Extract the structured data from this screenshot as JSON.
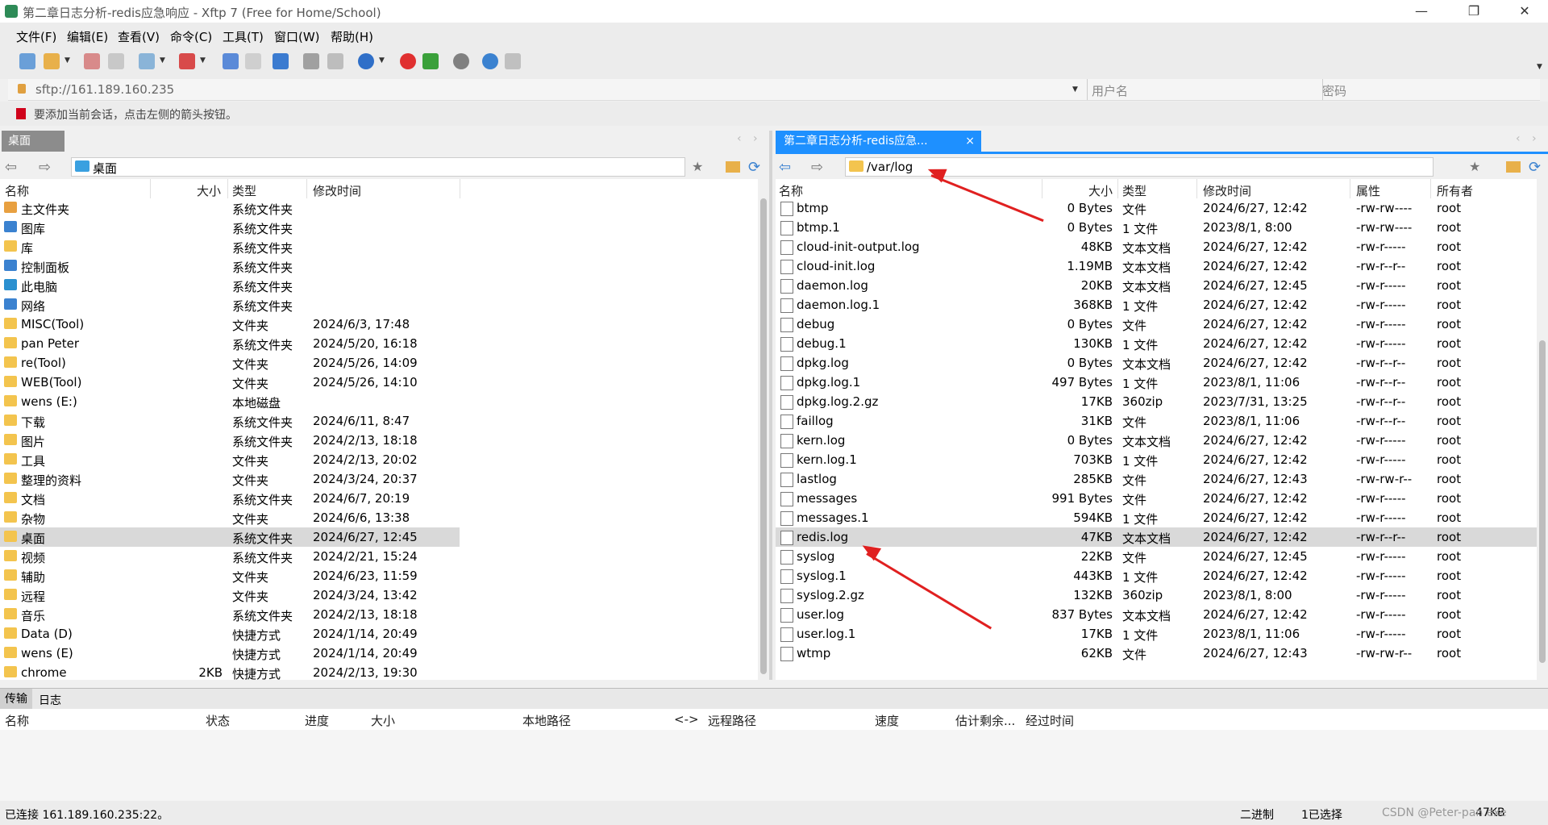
{
  "window": {
    "title": "第二章日志分析-redis应急响应 - Xftp 7 (Free for Home/School)",
    "minimize": "—",
    "restore": "❐",
    "close": "✕"
  },
  "menu": [
    "文件(F)",
    "编辑(E)",
    "查看(V)",
    "命令(C)",
    "工具(T)",
    "窗口(W)",
    "帮助(H)"
  ],
  "address": {
    "url": "sftp://161.189.160.235",
    "user_placeholder": "用户名",
    "password_placeholder": "密码"
  },
  "hint": "要添加当前会话，点击左侧的箭头按钮。",
  "left": {
    "tab": "桌面",
    "path": "桌面",
    "columns": [
      "名称",
      "大小",
      "类型",
      "修改时间"
    ],
    "rows": [
      {
        "name": "主文件夹",
        "size": "",
        "type": "系统文件夹",
        "date": ""
      },
      {
        "name": "图库",
        "size": "",
        "type": "系统文件夹",
        "date": ""
      },
      {
        "name": "库",
        "size": "",
        "type": "系统文件夹",
        "date": ""
      },
      {
        "name": "控制面板",
        "size": "",
        "type": "系统文件夹",
        "date": ""
      },
      {
        "name": "此电脑",
        "size": "",
        "type": "系统文件夹",
        "date": ""
      },
      {
        "name": "网络",
        "size": "",
        "type": "系统文件夹",
        "date": ""
      },
      {
        "name": "MISC(Tool)",
        "size": "",
        "type": "文件夹",
        "date": "2024/6/3, 17:48"
      },
      {
        "name": "pan Peter",
        "size": "",
        "type": "系统文件夹",
        "date": "2024/5/20, 16:18"
      },
      {
        "name": "re(Tool)",
        "size": "",
        "type": "文件夹",
        "date": "2024/5/26, 14:09"
      },
      {
        "name": "WEB(Tool)",
        "size": "",
        "type": "文件夹",
        "date": "2024/5/26, 14:10"
      },
      {
        "name": "wens (E:)",
        "size": "",
        "type": "本地磁盘",
        "date": ""
      },
      {
        "name": "下载",
        "size": "",
        "type": "系统文件夹",
        "date": "2024/6/11, 8:47"
      },
      {
        "name": "图片",
        "size": "",
        "type": "系统文件夹",
        "date": "2024/2/13, 18:18"
      },
      {
        "name": "工具",
        "size": "",
        "type": "文件夹",
        "date": "2024/2/13, 20:02"
      },
      {
        "name": "整理的资料",
        "size": "",
        "type": "文件夹",
        "date": "2024/3/24, 20:37"
      },
      {
        "name": "文档",
        "size": "",
        "type": "系统文件夹",
        "date": "2024/6/7, 20:19"
      },
      {
        "name": "杂物",
        "size": "",
        "type": "文件夹",
        "date": "2024/6/6, 13:38"
      },
      {
        "name": "桌面",
        "size": "",
        "type": "系统文件夹",
        "date": "2024/6/27, 12:45"
      },
      {
        "name": "视频",
        "size": "",
        "type": "系统文件夹",
        "date": "2024/2/21, 15:24"
      },
      {
        "name": "辅助",
        "size": "",
        "type": "文件夹",
        "date": "2024/6/23, 11:59"
      },
      {
        "name": "远程",
        "size": "",
        "type": "文件夹",
        "date": "2024/3/24, 13:42"
      },
      {
        "name": "音乐",
        "size": "",
        "type": "系统文件夹",
        "date": "2024/2/13, 18:18"
      },
      {
        "name": "Data (D)",
        "size": "",
        "type": "快捷方式",
        "date": "2024/1/14, 20:49"
      },
      {
        "name": "wens (E)",
        "size": "",
        "type": "快捷方式",
        "date": "2024/1/14, 20:49"
      },
      {
        "name": "chrome",
        "size": "2KB",
        "type": "快捷方式",
        "date": "2024/2/13, 19:30"
      }
    ]
  },
  "right": {
    "tab": "第二章日志分析-redis应急...",
    "tab_close": "×",
    "path": "/var/log",
    "columns": [
      "名称",
      "大小",
      "类型",
      "修改时间",
      "属性",
      "所有者"
    ],
    "rows": [
      {
        "name": "btmp",
        "size": "0 Bytes",
        "type": "文件",
        "date": "2024/6/27, 12:42",
        "perm": "-rw-rw----",
        "owner": "root"
      },
      {
        "name": "btmp.1",
        "size": "0 Bytes",
        "type": "1 文件",
        "date": "2023/8/1, 8:00",
        "perm": "-rw-rw----",
        "owner": "root"
      },
      {
        "name": "cloud-init-output.log",
        "size": "48KB",
        "type": "文本文档",
        "date": "2024/6/27, 12:42",
        "perm": "-rw-r-----",
        "owner": "root"
      },
      {
        "name": "cloud-init.log",
        "size": "1.19MB",
        "type": "文本文档",
        "date": "2024/6/27, 12:42",
        "perm": "-rw-r--r--",
        "owner": "root"
      },
      {
        "name": "daemon.log",
        "size": "20KB",
        "type": "文本文档",
        "date": "2024/6/27, 12:45",
        "perm": "-rw-r-----",
        "owner": "root"
      },
      {
        "name": "daemon.log.1",
        "size": "368KB",
        "type": "1 文件",
        "date": "2024/6/27, 12:42",
        "perm": "-rw-r-----",
        "owner": "root"
      },
      {
        "name": "debug",
        "size": "0 Bytes",
        "type": "文件",
        "date": "2024/6/27, 12:42",
        "perm": "-rw-r-----",
        "owner": "root"
      },
      {
        "name": "debug.1",
        "size": "130KB",
        "type": "1 文件",
        "date": "2024/6/27, 12:42",
        "perm": "-rw-r-----",
        "owner": "root"
      },
      {
        "name": "dpkg.log",
        "size": "0 Bytes",
        "type": "文本文档",
        "date": "2024/6/27, 12:42",
        "perm": "-rw-r--r--",
        "owner": "root"
      },
      {
        "name": "dpkg.log.1",
        "size": "497 Bytes",
        "type": "1 文件",
        "date": "2023/8/1, 11:06",
        "perm": "-rw-r--r--",
        "owner": "root"
      },
      {
        "name": "dpkg.log.2.gz",
        "size": "17KB",
        "type": "360zip",
        "date": "2023/7/31, 13:25",
        "perm": "-rw-r--r--",
        "owner": "root"
      },
      {
        "name": "faillog",
        "size": "31KB",
        "type": "文件",
        "date": "2023/8/1, 11:06",
        "perm": "-rw-r--r--",
        "owner": "root"
      },
      {
        "name": "kern.log",
        "size": "0 Bytes",
        "type": "文本文档",
        "date": "2024/6/27, 12:42",
        "perm": "-rw-r-----",
        "owner": "root"
      },
      {
        "name": "kern.log.1",
        "size": "703KB",
        "type": "1 文件",
        "date": "2024/6/27, 12:42",
        "perm": "-rw-r-----",
        "owner": "root"
      },
      {
        "name": "lastlog",
        "size": "285KB",
        "type": "文件",
        "date": "2024/6/27, 12:43",
        "perm": "-rw-rw-r--",
        "owner": "root"
      },
      {
        "name": "messages",
        "size": "991 Bytes",
        "type": "文件",
        "date": "2024/6/27, 12:42",
        "perm": "-rw-r-----",
        "owner": "root"
      },
      {
        "name": "messages.1",
        "size": "594KB",
        "type": "1 文件",
        "date": "2024/6/27, 12:42",
        "perm": "-rw-r-----",
        "owner": "root"
      },
      {
        "name": "redis.log",
        "size": "47KB",
        "type": "文本文档",
        "date": "2024/6/27, 12:42",
        "perm": "-rw-r--r--",
        "owner": "root"
      },
      {
        "name": "syslog",
        "size": "22KB",
        "type": "文件",
        "date": "2024/6/27, 12:45",
        "perm": "-rw-r-----",
        "owner": "root"
      },
      {
        "name": "syslog.1",
        "size": "443KB",
        "type": "1 文件",
        "date": "2024/6/27, 12:42",
        "perm": "-rw-r-----",
        "owner": "root"
      },
      {
        "name": "syslog.2.gz",
        "size": "132KB",
        "type": "360zip",
        "date": "2023/8/1, 8:00",
        "perm": "-rw-r-----",
        "owner": "root"
      },
      {
        "name": "user.log",
        "size": "837 Bytes",
        "type": "文本文档",
        "date": "2024/6/27, 12:42",
        "perm": "-rw-r-----",
        "owner": "root"
      },
      {
        "name": "user.log.1",
        "size": "17KB",
        "type": "1 文件",
        "date": "2023/8/1, 11:06",
        "perm": "-rw-r-----",
        "owner": "root"
      },
      {
        "name": "wtmp",
        "size": "62KB",
        "type": "文件",
        "date": "2024/6/27, 12:43",
        "perm": "-rw-rw-r--",
        "owner": "root"
      }
    ]
  },
  "transfer": {
    "tabs": [
      "传输",
      "日志"
    ],
    "columns": [
      "名称",
      "状态",
      "进度",
      "大小",
      "本地路径",
      "<->",
      "远程路径",
      "速度",
      "估计剩余...",
      "经过时间"
    ]
  },
  "status": {
    "connected": "已连接 161.189.160.235:22。",
    "mode": "二进制",
    "selected": "1已选择",
    "size": "47KB",
    "watermark": "CSDN @Peter-pan.exe"
  },
  "colors": {
    "accent": "#1e90ff",
    "annotation": "#e02020",
    "selection": "#d9d9d9"
  }
}
